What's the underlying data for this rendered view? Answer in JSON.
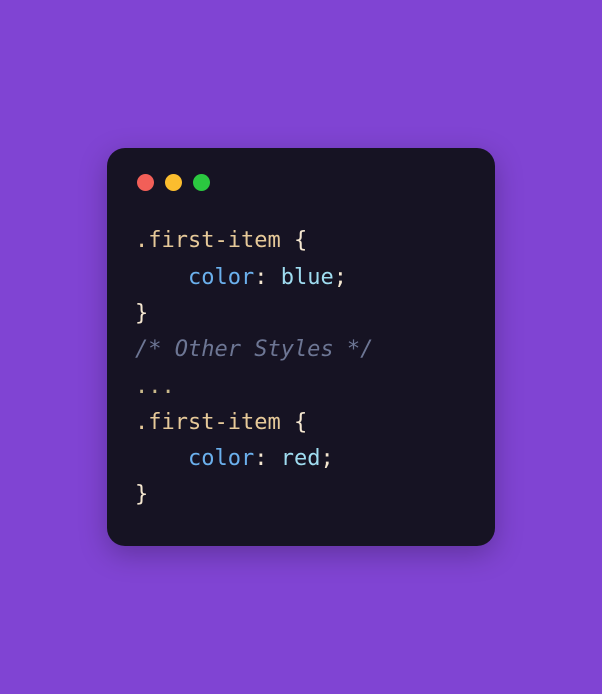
{
  "colors": {
    "page_bg": "#8044d3",
    "editor_bg": "#161323",
    "traffic_red": "#f25f58",
    "traffic_yellow": "#fbbd2e",
    "traffic_green": "#2bc840"
  },
  "code": {
    "rule1": {
      "selector": ".first-item",
      "open": " {",
      "indent": "    ",
      "prop": "color",
      "colon": ": ",
      "value": "blue",
      "semi": ";",
      "close": "}"
    },
    "comment": "/* Other Styles */",
    "ellipsis": "...",
    "rule2": {
      "selector": ".first-item",
      "open": " {",
      "indent": "    ",
      "prop": "color",
      "colon": ": ",
      "value": "red",
      "semi": ";",
      "close": "}"
    }
  }
}
